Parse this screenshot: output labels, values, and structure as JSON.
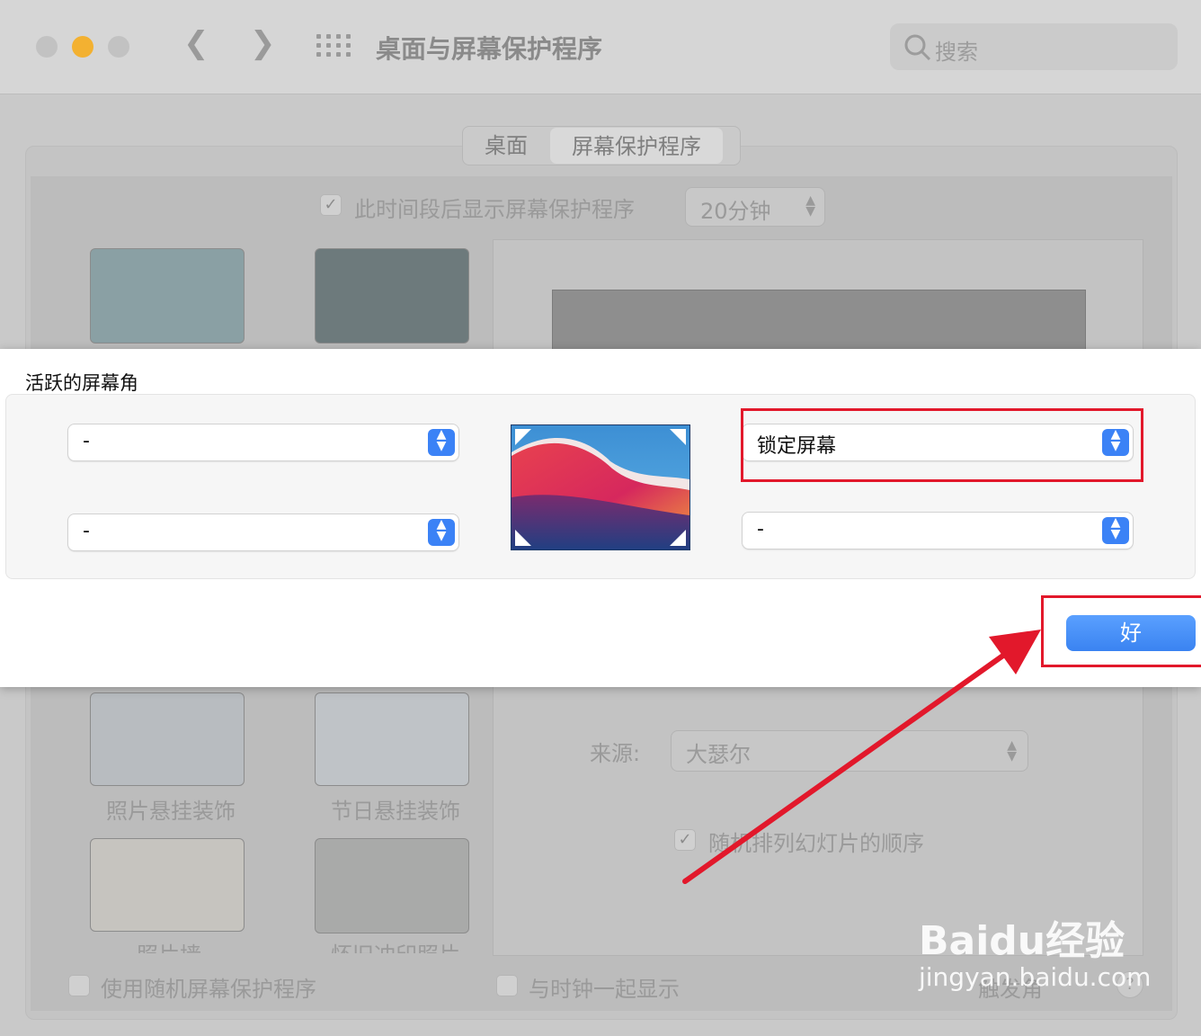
{
  "window": {
    "title": "桌面与屏幕保护程序",
    "search_placeholder": "搜索"
  },
  "tabs": [
    {
      "label": "桌面",
      "active": false
    },
    {
      "label": "屏幕保护程序",
      "active": true
    }
  ],
  "screensaver": {
    "show_after_label": "此时间段后显示屏幕保护程序",
    "show_after_checked": true,
    "show_after_value": "20分钟",
    "thumbnails": [
      {
        "label": "照片悬挂装饰"
      },
      {
        "label": "节日悬挂装饰"
      },
      {
        "label": "照片墙"
      },
      {
        "label": "怀旧冲印照片"
      }
    ],
    "source_label": "来源:",
    "source_value": "大瑟尔",
    "shuffle_label": "随机排列幻灯片的顺序",
    "shuffle_checked": true,
    "random_label": "使用随机屏幕保护程序",
    "clock_label": "与时钟一起显示",
    "hot_corners_label": "触发角"
  },
  "sheet": {
    "title": "活跃的屏幕角",
    "top_left": "-",
    "bottom_left": "-",
    "top_right": "锁定屏幕",
    "bottom_right": "-",
    "ok_label": "好"
  },
  "watermark": {
    "logo": "Baidu经验",
    "url": "jingyan.baidu.com"
  },
  "colors": {
    "accent": "#3b82f6",
    "highlight": "#e2182b"
  }
}
